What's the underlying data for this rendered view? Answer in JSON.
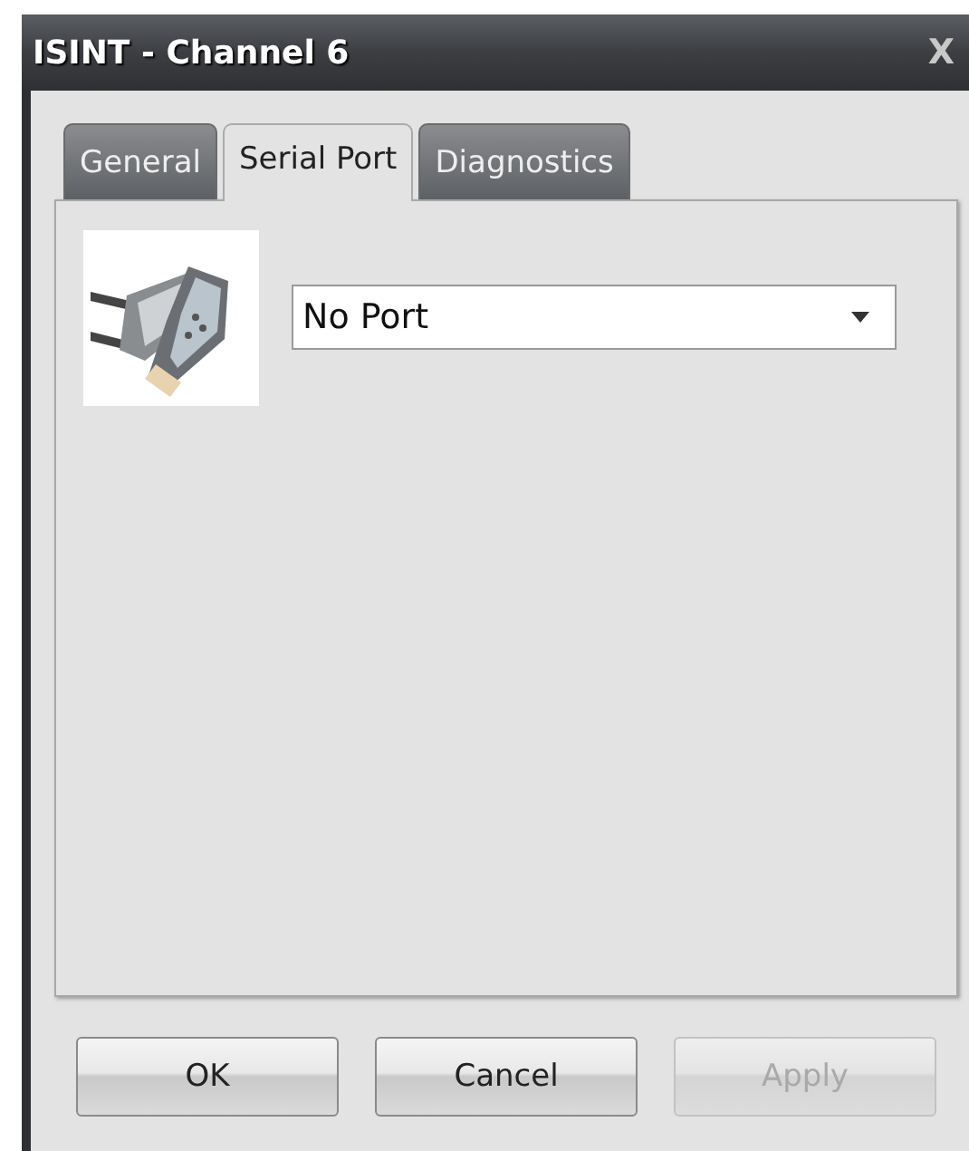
{
  "window": {
    "title": "ISINT - Channel 6",
    "close": "X"
  },
  "tabs": [
    {
      "label": "General",
      "selected": false
    },
    {
      "label": "Serial Port",
      "selected": true
    },
    {
      "label": "Diagnostics",
      "selected": false
    }
  ],
  "port_select": {
    "value": "No Port"
  },
  "buttons": [
    {
      "label": "OK",
      "disabled": false
    },
    {
      "label": "Cancel",
      "disabled": false
    },
    {
      "label": "Apply",
      "disabled": true
    }
  ]
}
